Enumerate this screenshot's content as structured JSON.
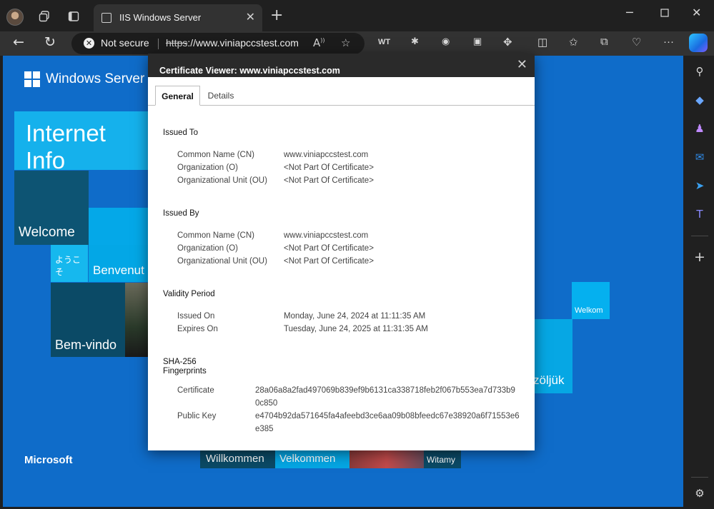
{
  "browser": {
    "tab": {
      "title": "IIS Windows Server"
    },
    "toolbar": {
      "security_label": "Not secure",
      "url_scheme": "https",
      "url_rest": "://www.viniapccstest.com",
      "ext_wt": "WT"
    }
  },
  "page": {
    "product": "Windows Server",
    "banner": "Internet Info",
    "tiles": {
      "welcome": "Welcome",
      "japanese": "ようこそ",
      "italian": "Benvenut",
      "portuguese": "Bem-vindo",
      "dutch": "Welkom",
      "hungarian": "zöljük",
      "german": "Willkommen",
      "danish": "Velkommen",
      "polish": "Witamy"
    },
    "footer_brand": "Microsoft"
  },
  "dialog": {
    "title": "Certificate Viewer: www.viniapccstest.com",
    "tabs": [
      "General",
      "Details"
    ],
    "issued_to": {
      "heading": "Issued To",
      "rows": [
        {
          "label": "Common Name (CN)",
          "value": "www.viniapccstest.com"
        },
        {
          "label": "Organization (O)",
          "value": "<Not Part Of Certificate>"
        },
        {
          "label": "Organizational Unit (OU)",
          "value": "<Not Part Of Certificate>"
        }
      ]
    },
    "issued_by": {
      "heading": "Issued By",
      "rows": [
        {
          "label": "Common Name (CN)",
          "value": "www.viniapccstest.com"
        },
        {
          "label": "Organization (O)",
          "value": "<Not Part Of Certificate>"
        },
        {
          "label": "Organizational Unit (OU)",
          "value": "<Not Part Of Certificate>"
        }
      ]
    },
    "validity": {
      "heading": "Validity Period",
      "rows": [
        {
          "label": "Issued On",
          "value": "Monday, June 24, 2024 at 11:11:35 AM"
        },
        {
          "label": "Expires On",
          "value": "Tuesday, June 24, 2025 at 11:31:35 AM"
        }
      ]
    },
    "fingerprints": {
      "heading_line1": "SHA-256",
      "heading_line2": "Fingerprints",
      "rows": [
        {
          "label": "Certificate",
          "value": "28a06a8a2fad497069b839ef9b6131ca338718feb2f067b553ea7d733b90c850"
        },
        {
          "label": "Public Key",
          "value": "e4704b92da571645fa4afeebd3ce6aa09b08bfeedc67e38920a6f71553e6e385"
        }
      ]
    }
  }
}
